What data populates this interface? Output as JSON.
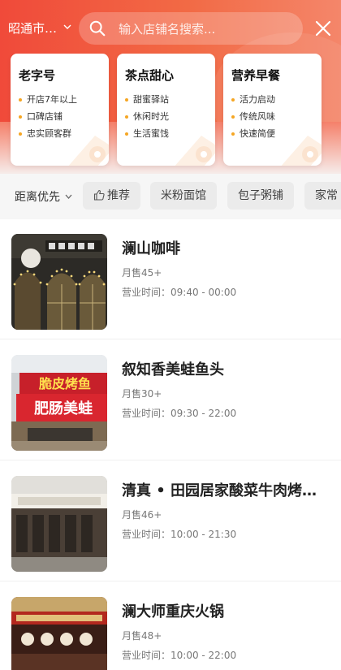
{
  "header": {
    "city": "昭通市…",
    "search_placeholder": "输入店铺名搜索..."
  },
  "categories": [
    {
      "title": "老字号",
      "items": [
        "开店7年以上",
        "口碑店铺",
        "忠实顾客群"
      ]
    },
    {
      "title": "茶点甜心",
      "items": [
        "甜蜜驿站",
        "休闲时光",
        "生活蜜饯"
      ]
    },
    {
      "title": "营养早餐",
      "items": [
        "活力启动",
        "传统风味",
        "快速简便"
      ]
    }
  ],
  "filters": {
    "sort_label": "距离优先",
    "chips": [
      "推荐",
      "米粉面馆",
      "包子粥铺",
      "家常"
    ]
  },
  "shops": [
    {
      "name": "澜山咖啡",
      "sales": "月售45+",
      "hours": "营业时间：09:40 - 00:00"
    },
    {
      "name": "叙知香美蛙鱼头",
      "sales": "月售30+",
      "hours": "营业时间：09:30 - 22:00",
      "sign_text_1": "脆皮烤鱼",
      "sign_text_2": "肥肠美蛙"
    },
    {
      "name": "清真 • 田园居家酸菜牛肉烤…",
      "sales": "月售46+",
      "hours": "营业时间：10:00 - 21:30"
    },
    {
      "name": "澜大师重庆火锅",
      "sales": "月售48+",
      "hours": "营业时间：10:00 - 22:00"
    }
  ],
  "colors": {
    "brand_red": "#f04a3a",
    "brand_orange": "#f4866a",
    "bullet": "#f5a623"
  }
}
